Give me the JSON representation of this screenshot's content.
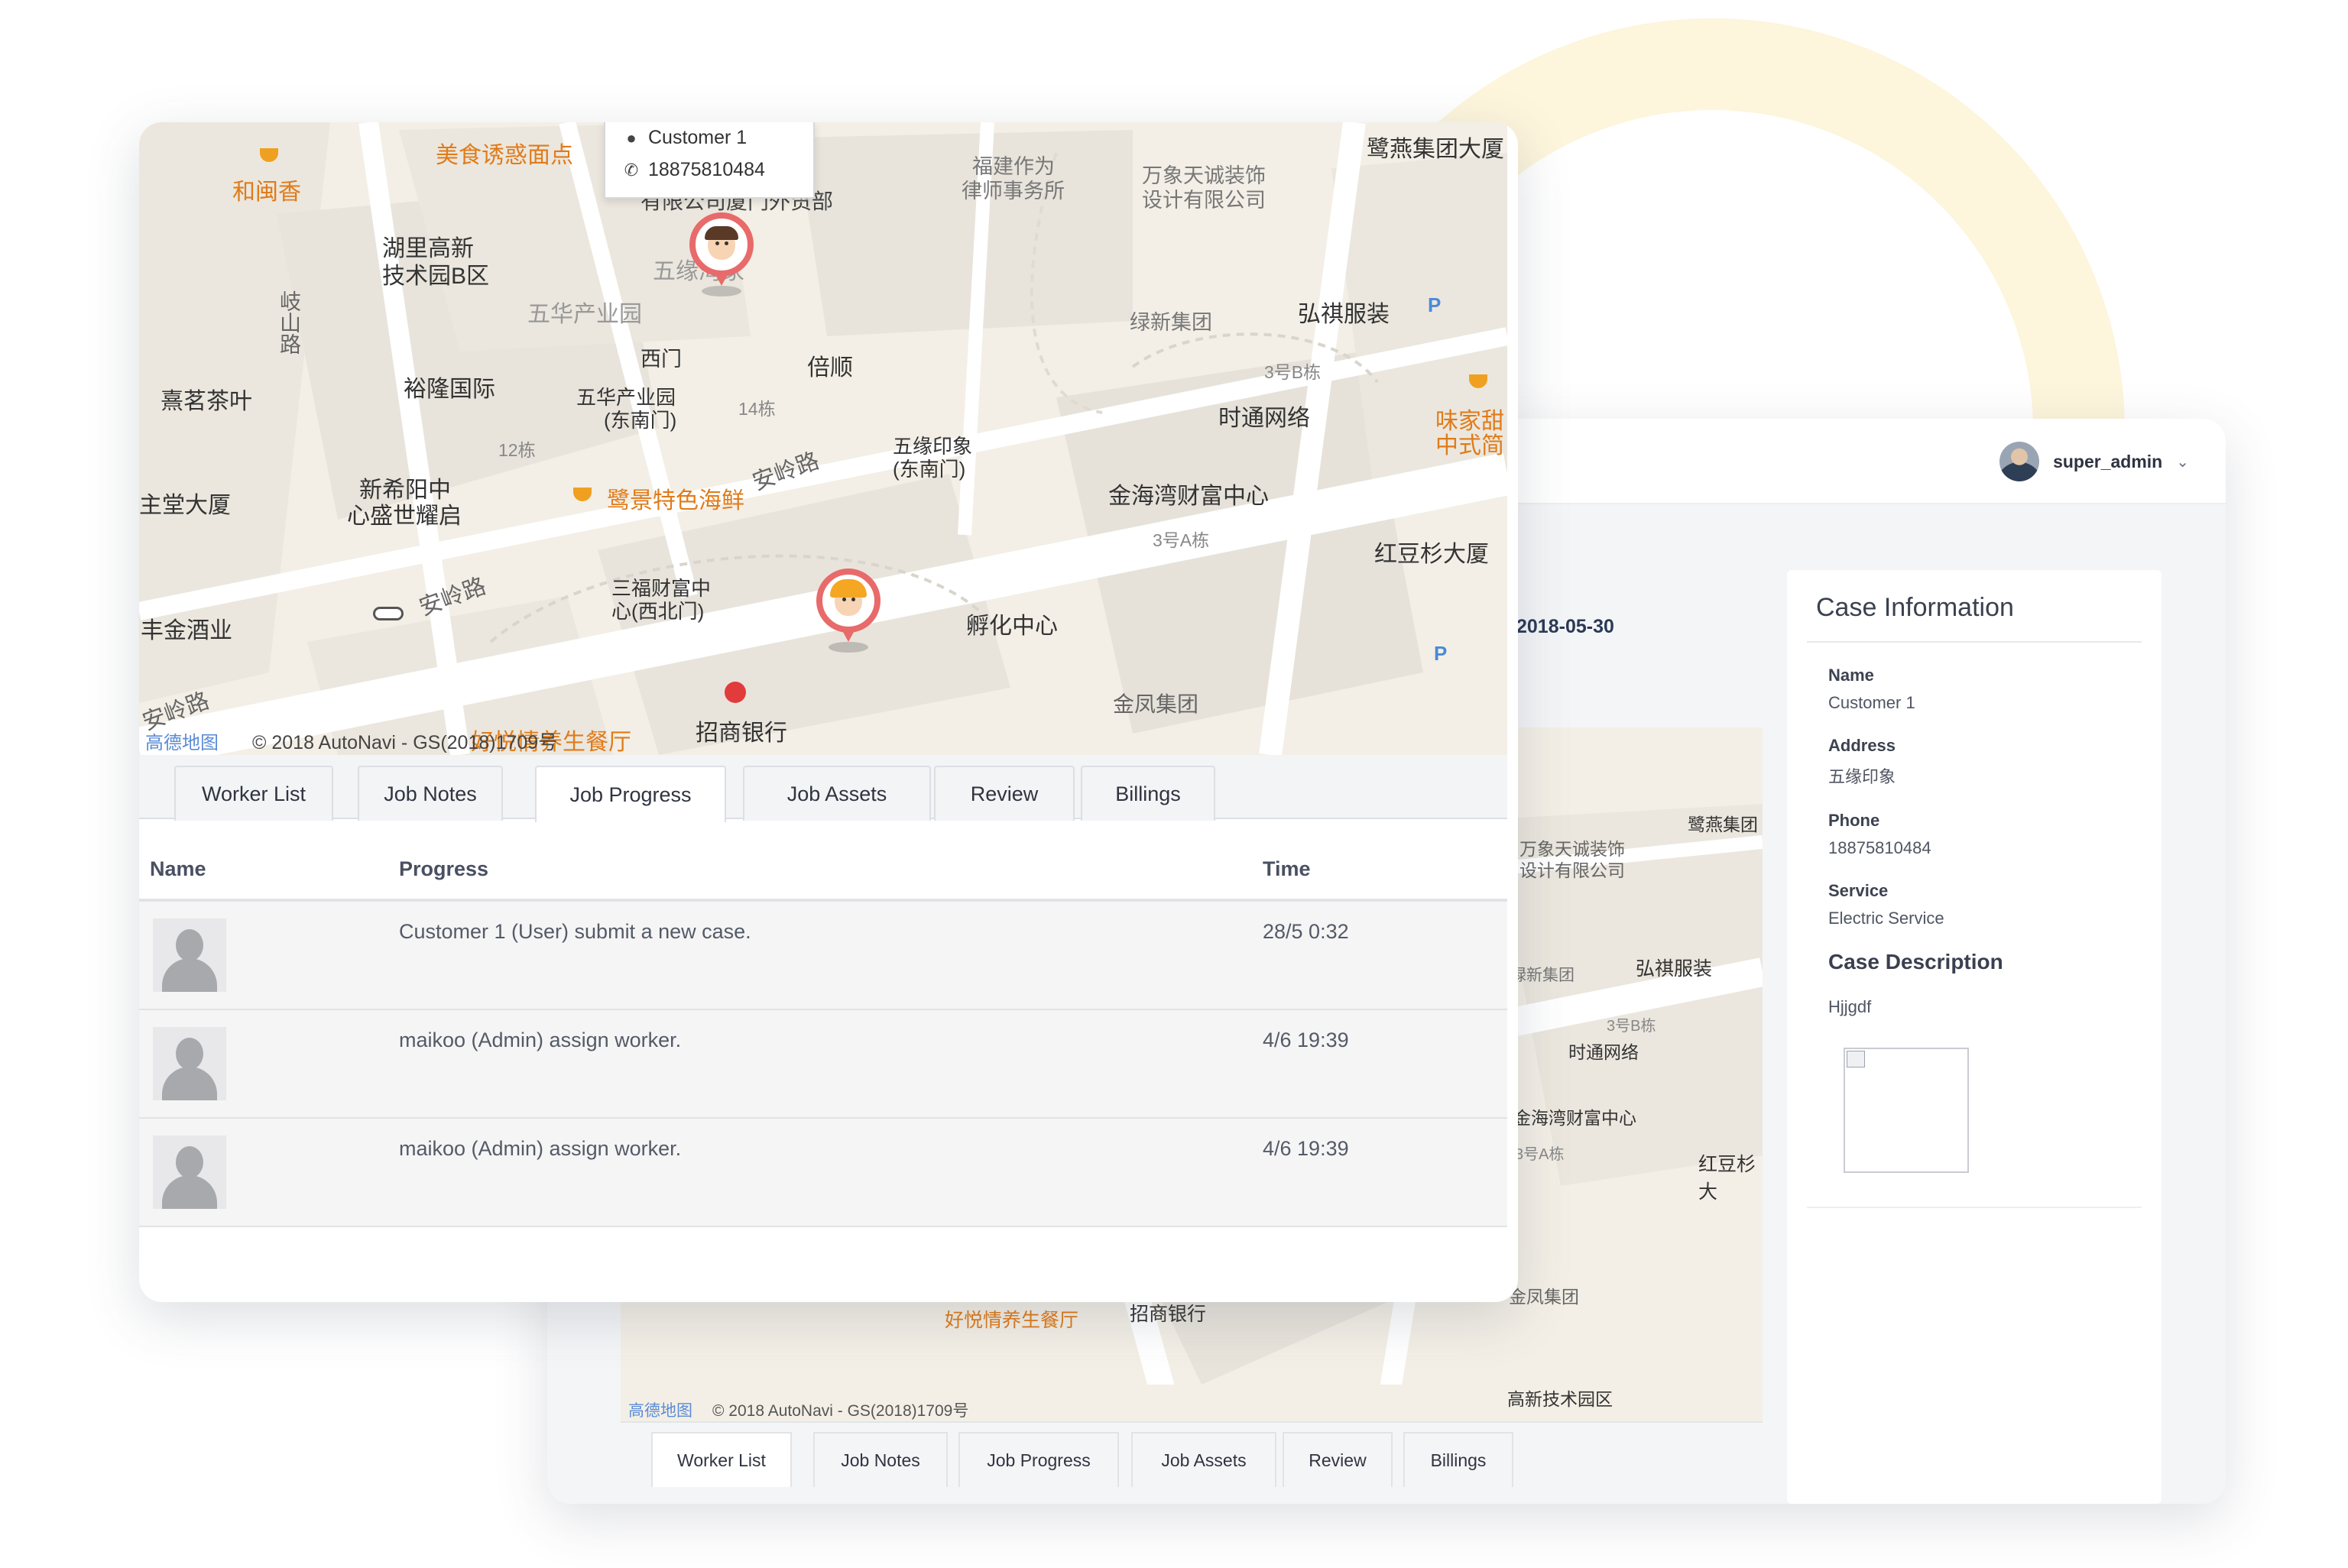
{
  "back_window": {
    "user": {
      "name": "super_admin"
    },
    "date": "2018-05-30",
    "case_info": {
      "title": "Case Information",
      "fields": [
        {
          "label": "Name",
          "value": "Customer 1"
        },
        {
          "label": "Address",
          "value": "五缘印象"
        },
        {
          "label": "Phone",
          "value": "18875810484"
        },
        {
          "label": "Service",
          "value": "Electric Service"
        }
      ],
      "description_title": "Case Description",
      "description": "Hjjgdf"
    },
    "map_labels": {
      "l1": "鹭燕集团",
      "l2": "万象天诚装饰",
      "l3": "设计有限公司",
      "l4": "绿新集团",
      "l5": "弘祺服装",
      "l6": "3号B栋",
      "l7": "时通网络",
      "l8": "金海湾财富中心",
      "l9": "3号A栋",
      "l10": "红豆杉大",
      "l11": "金凤集团",
      "l12": "好悦情养生餐厅",
      "l13": "招商银行",
      "l14": "高新技术园区",
      "copyright": "© 2018 AutoNavi - GS(2018)1709号",
      "logo": "高德地图"
    },
    "tabs": [
      "Worker List",
      "Job Notes",
      "Job Progress",
      "Job Assets",
      "Review",
      "Billings"
    ],
    "active_tab": "Worker List"
  },
  "front_window": {
    "customer_popup": {
      "name": "Customer 1",
      "phone": "18875810484"
    },
    "map_labels": {
      "hemin": "和闽香",
      "meishi": "美食诱惑面点",
      "youxian": "有限公司厦门外贸部",
      "fujian1": "福建作为",
      "fujian2": "律师事务所",
      "wanxiang1": "万象天诚装饰",
      "wanxiang2": "设计有限公司",
      "luyan": "鹭燕集团大厦",
      "huli1": "湖里高新",
      "huli2": "技术园B区",
      "wuyuan_jia": "五缘湾家",
      "wuhua": "五华产业园",
      "xishan": "岐山路",
      "lvxin": "绿新集团",
      "hongqi": "弘祺服装",
      "beishun": "倍顺",
      "ximen": "西门",
      "yulong": "裕隆国际",
      "xiangming": "熹茗茶叶",
      "b3": "3号B栋",
      "wuhua_dn1": "五华产业园",
      "wuhua_dn2": "(东南门)",
      "b14": "14栋",
      "shitong": "时通网络",
      "weijia1": "味家甜",
      "weijia2": "中式简",
      "b12": "12栋",
      "wuyuan_yx1": "五缘印象",
      "wuyuan_yx2": "(东南门)",
      "xinxiyang1": "新希阳中",
      "xinxiyang2": "心盛世耀启",
      "jinhaiwan": "金海湾财富中心",
      "zhutang": "主堂大厦",
      "lujing": "鹭景特色海鲜",
      "anling1": "安岭路",
      "a3": "3号A栋",
      "hongdou": "红豆杉大厦",
      "sanfu1": "三福财富中",
      "sanfu2": "心(西北门)",
      "anling2": "安岭路",
      "fuhua": "孵化中心",
      "fengjin": "丰金酒业",
      "jinfeng": "金凤集团",
      "anling3": "安岭路",
      "haoyue": "好悦情养生餐厅",
      "zhaoshang": "招商银行",
      "logo": "高德地图",
      "copyright": "© 2018 AutoNavi - GS(2018)1709号",
      "parking": "P"
    },
    "tabs": [
      "Worker List",
      "Job Notes",
      "Job Progress",
      "Job Assets",
      "Review",
      "Billings"
    ],
    "active_tab": "Job Progress",
    "table": {
      "headers": {
        "name": "Name",
        "progress": "Progress",
        "time": "Time"
      },
      "rows": [
        {
          "progress": "Customer 1 (User) submit a new case.",
          "time": "28/5 0:32"
        },
        {
          "progress": "maikoo (Admin) assign worker.",
          "time": "4/6 19:39"
        },
        {
          "progress": "maikoo (Admin) assign worker.",
          "time": "4/6 19:39"
        }
      ]
    }
  },
  "colors": {
    "accent_arc": "#fdf5dc",
    "pin": "#e86a6a",
    "map_bg": "#f3efe6",
    "map_block": "#e8e5de",
    "map_road": "#ffffff",
    "poi_orange": "#e07b1a"
  }
}
